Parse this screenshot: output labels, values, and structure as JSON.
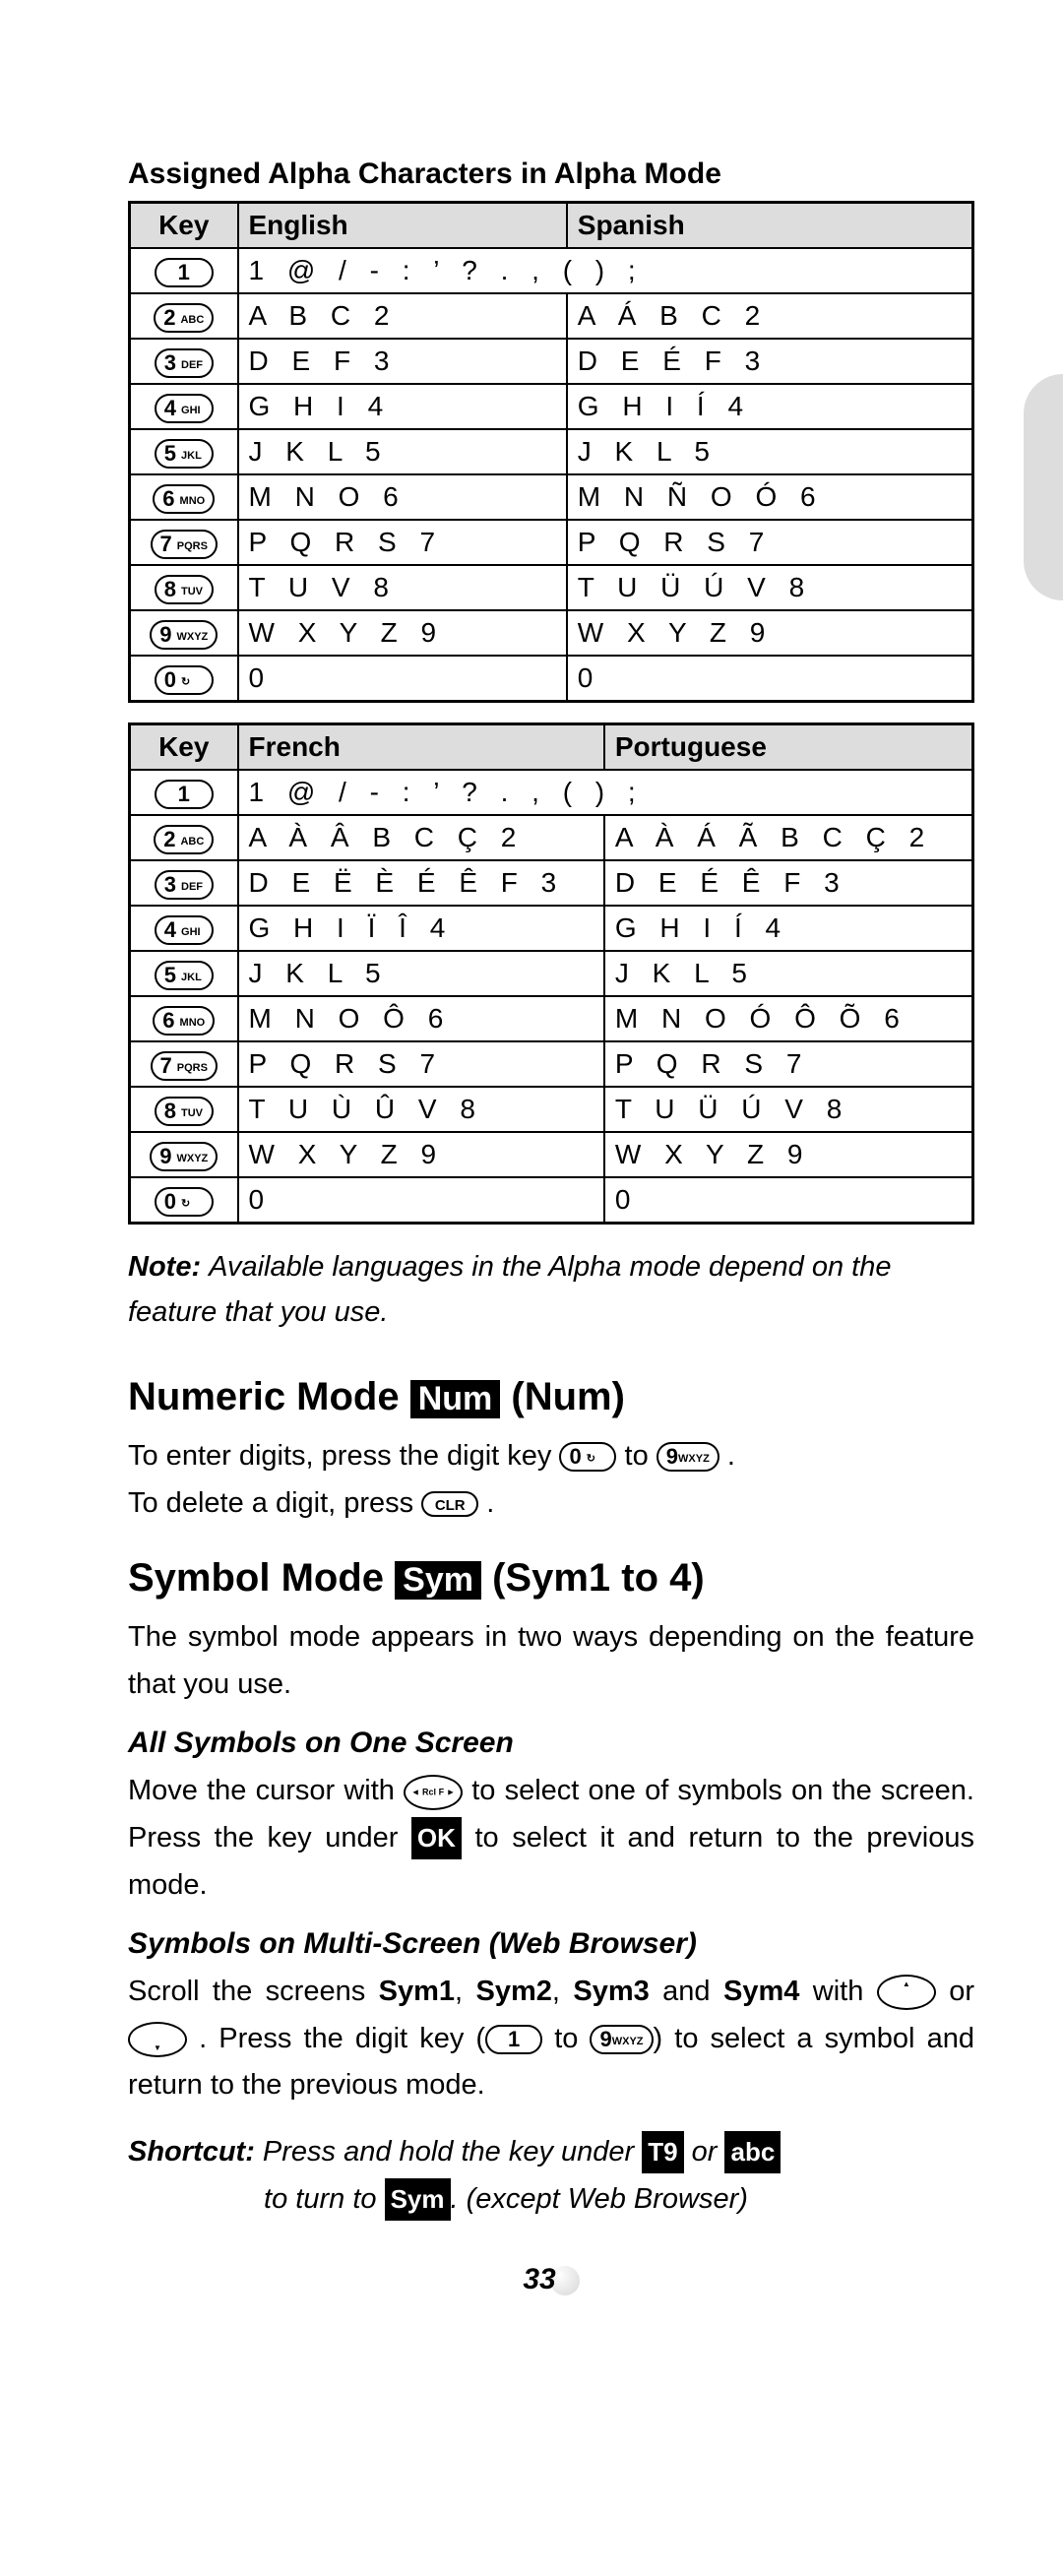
{
  "caption1": "Assigned Alpha Characters in Alpha Mode",
  "table1": {
    "headers": {
      "key": "Key",
      "col1": "English",
      "col2": "Spanish"
    },
    "rows": [
      {
        "keyNum": "1",
        "keySub": "",
        "c1": "1 @ / - : ’ ? . , ( ) ;",
        "c2": ""
      },
      {
        "keyNum": "2",
        "keySub": "ABC",
        "c1": "A B C 2",
        "c2": "A Á B C 2"
      },
      {
        "keyNum": "3",
        "keySub": "DEF",
        "c1": "D E F 3",
        "c2": "D E É F 3"
      },
      {
        "keyNum": "4",
        "keySub": "GHI",
        "c1": "G H I 4",
        "c2": "G H I Í 4"
      },
      {
        "keyNum": "5",
        "keySub": "JKL",
        "c1": "J K L 5",
        "c2": "J K L 5"
      },
      {
        "keyNum": "6",
        "keySub": "MNO",
        "c1": "M N O 6",
        "c2": "M N Ñ O Ó 6"
      },
      {
        "keyNum": "7",
        "keySub": "PQRS",
        "c1": "P Q R S 7",
        "c2": "P Q R S 7"
      },
      {
        "keyNum": "8",
        "keySub": "TUV",
        "c1": "T U V 8",
        "c2": "T U Ü Ú V 8"
      },
      {
        "keyNum": "9",
        "keySub": "WXYZ",
        "c1": "W X Y Z 9",
        "c2": "W X Y Z 9"
      },
      {
        "keyNum": "0",
        "keySub": "↻",
        "c1": "0",
        "c2": "0"
      }
    ]
  },
  "table2": {
    "headers": {
      "key": "Key",
      "col1": "French",
      "col2": "Portuguese"
    },
    "rows": [
      {
        "keyNum": "1",
        "keySub": "",
        "c1": "1 @ / - : ’ ? . , ( ) ;",
        "c2": ""
      },
      {
        "keyNum": "2",
        "keySub": "ABC",
        "c1": "A À Â B C Ç 2",
        "c2": "A À Á Ã B C Ç 2"
      },
      {
        "keyNum": "3",
        "keySub": "DEF",
        "c1": "D E Ë È É Ê F 3",
        "c2": "D E É Ê F 3"
      },
      {
        "keyNum": "4",
        "keySub": "GHI",
        "c1": "G H I Ï Î 4",
        "c2": "G H I Í 4"
      },
      {
        "keyNum": "5",
        "keySub": "JKL",
        "c1": "J K L 5",
        "c2": "J K L 5"
      },
      {
        "keyNum": "6",
        "keySub": "MNO",
        "c1": "M N O Ô 6",
        "c2": "M N O Ó Ô Õ 6"
      },
      {
        "keyNum": "7",
        "keySub": "PQRS",
        "c1": "P Q R S 7",
        "c2": "P Q R S 7"
      },
      {
        "keyNum": "8",
        "keySub": "TUV",
        "c1": "T U Ù Û V 8",
        "c2": "T U Ü Ú V 8"
      },
      {
        "keyNum": "9",
        "keySub": "WXYZ",
        "c1": "W X Y Z 9",
        "c2": "W X Y Z 9"
      },
      {
        "keyNum": "0",
        "keySub": "↻",
        "c1": "0",
        "c2": "0"
      }
    ]
  },
  "note": {
    "label": "Note:",
    "body": "Available languages in the Alpha mode depend on the feature that you use."
  },
  "numeric": {
    "heading_pre": "Numeric Mode ",
    "badge": "Num",
    "heading_post": " (Num)",
    "line1_a": "To enter digits, press the digit key ",
    "key0_num": "0",
    "key0_sub": "↻",
    "line1_b": " to ",
    "key9_num": "9",
    "key9_sub": "WXYZ",
    "line1_c": " .",
    "line2_a": "To delete a digit, press ",
    "keyclr": "CLR",
    "line2_b": " ."
  },
  "symbol": {
    "heading_pre": "Symbol Mode ",
    "badge": "Sym",
    "heading_post": " (Sym1 to 4)",
    "intro": "The symbol mode appears in two ways depending on the feature that you use.",
    "sub1": "All Symbols on One Screen",
    "p1_a": "Move the cursor with ",
    "p1_b": " to select one of symbols on the screen. Press the key under ",
    "ok": "OK",
    "p1_c": " to select it and return to the previous mode.",
    "sub2": "Symbols on Multi-Screen (Web Browser)",
    "p2_a": "Scroll the screens ",
    "s1": "Sym1",
    "s2": "Sym2",
    "s3": "Sym3",
    "s4": "Sym4",
    "p2_b": " with ",
    "p2_c": " or ",
    "p2_d": ". Press the digit key (",
    "key1": "1",
    "p2_e": " to ",
    "key9_num": "9",
    "key9_sub": "WXYZ",
    "p2_f": ") to select a symbol and return to the previous mode."
  },
  "shortcut": {
    "label": "Shortcut:",
    "a": " Press and hold the key under ",
    "t9": "T9",
    "b": " or ",
    "abc": "abc",
    "c": " to turn to ",
    "sym": "Sym",
    "d": ". (except Web Browser)"
  },
  "pageNumber": "33"
}
